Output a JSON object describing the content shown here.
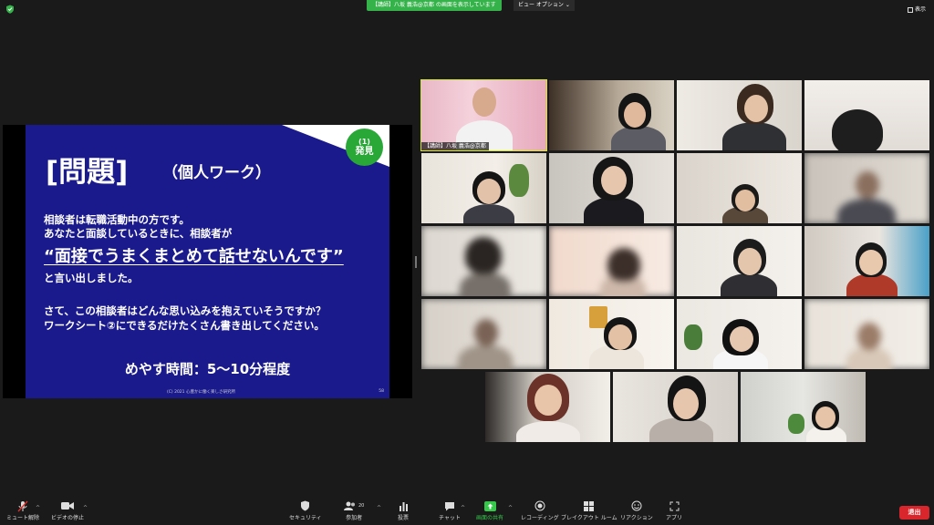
{
  "top": {
    "share_banner": "【講師】八坂 義浩@京都 の画面を表示しています",
    "view_options": "ビュー オプション ⌄",
    "display_label": "表示"
  },
  "slide": {
    "badge_number": "(1)",
    "badge_text": "発見",
    "title": "[問題]",
    "subtitle": "（個人ワーク）",
    "line1": "相談者は転職活動中の方です。",
    "line2": "あなたと面談しているときに、相談者が",
    "quote": "“面接でうまくまとめて話せないんです”",
    "line3": "と言い出しました。",
    "line4": "さて、この相談者はどんな思い込みを抱えていそうですか？",
    "line5": "ワークシート②にできるだけたくさん書き出してください。",
    "time": "めやす時間：5〜10分程度",
    "copyright": "(C) 2021 心豊かに働く楽しさ研究所",
    "page_number": "58"
  },
  "gallery": {
    "host_name": "【講師】八坂 義浩@京都"
  },
  "toolbar": {
    "mute": "ミュート解除",
    "video": "ビデオの停止",
    "security": "セキュリティ",
    "participants": "参加者",
    "participants_count": "20",
    "polls": "投票",
    "chat": "チャット",
    "share": "画面の共有",
    "record": "レコーディング",
    "breakout": "ブレイクアウト ルーム",
    "reactions": "リアクション",
    "apps": "アプリ",
    "leave": "退出"
  },
  "colors": {
    "slide_background": "#1a1a8c",
    "badge": "#29a838",
    "banner": "#35b34a",
    "active_speaker": "#d6e629",
    "leave": "#d9262c"
  }
}
